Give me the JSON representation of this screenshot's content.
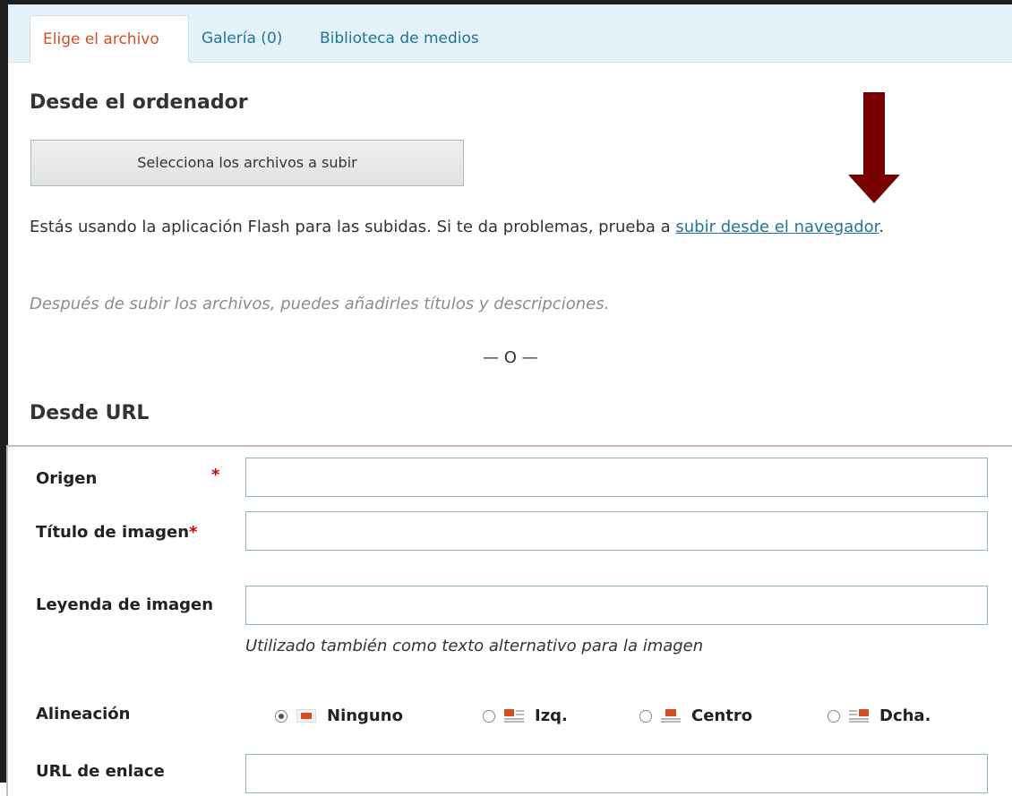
{
  "tabs": [
    {
      "label": "Elige el archivo",
      "active": true
    },
    {
      "label": "Galería (0)",
      "active": false
    },
    {
      "label": "Biblioteca de medios",
      "active": false
    }
  ],
  "computer": {
    "heading": "Desde el ordenador",
    "select_button": "Selecciona los archivos a subir",
    "flash_text_before": "Estás usando la aplicación Flash para las subidas. Si te da problemas, prueba a ",
    "flash_link": "subir desde el navegador",
    "flash_text_after": ".",
    "hint": "Después de subir los archivos, puedes añadirles títulos y descripciones.",
    "or": "— O —"
  },
  "url_section": {
    "heading": "Desde URL",
    "fields": {
      "origen": {
        "label": "Origen",
        "value": ""
      },
      "titulo": {
        "label": "Título de imagen",
        "value": ""
      },
      "leyenda": {
        "label": "Leyenda de imagen",
        "value": "",
        "help": "Utilizado también como texto alternativo para la imagen"
      },
      "alineacion": {
        "label": "Alineación",
        "options": [
          "Ninguno",
          "Izq.",
          "Centro",
          "Dcha."
        ],
        "selected": "Ninguno"
      },
      "enlace": {
        "label": "URL de enlace",
        "value": ""
      }
    },
    "required_mark": "*"
  },
  "colors": {
    "accent": "#21759b",
    "active_tab": "#d54e21",
    "arrow": "#7a0000",
    "icon": "#d54e21",
    "required": "#d60000"
  }
}
